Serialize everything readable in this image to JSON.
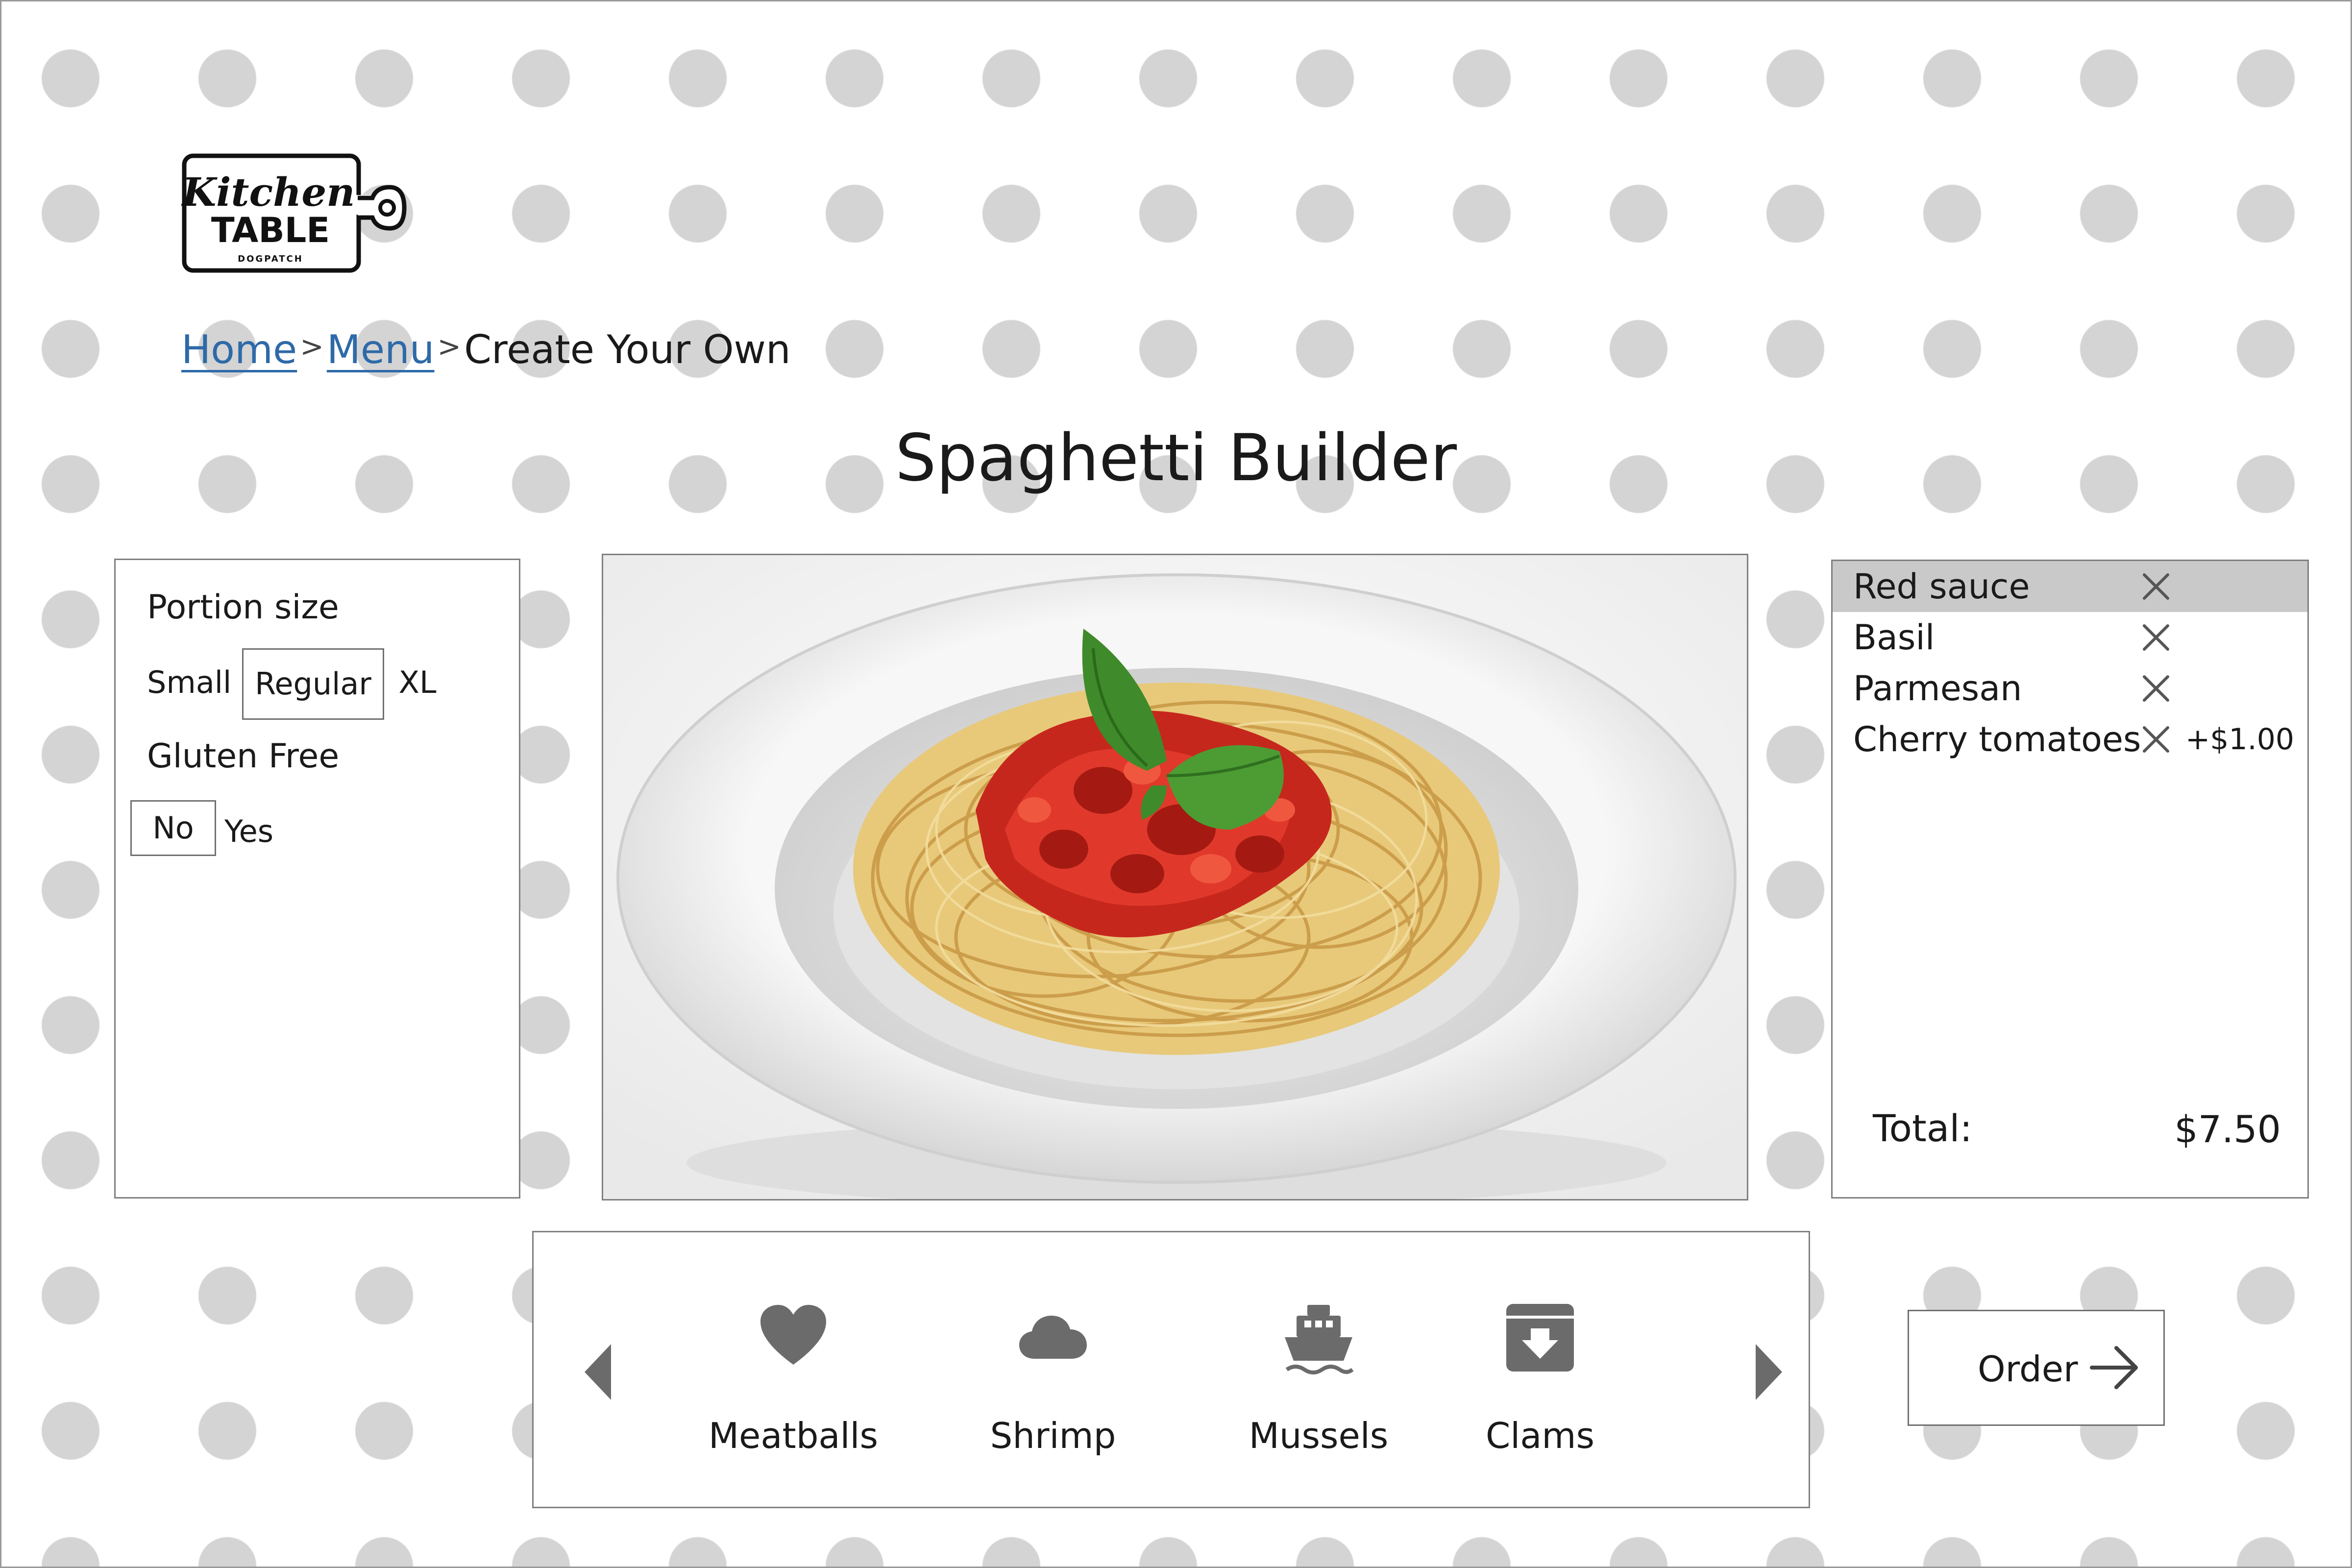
{
  "brand": {
    "logo_text_line1": "Kitchen",
    "logo_text_line2": "TABLE",
    "logo_text_line3": "DOGPATCH"
  },
  "breadcrumb": {
    "items": [
      "Home",
      "Menu"
    ],
    "current": "Create Your Own",
    "separator": ">"
  },
  "page": {
    "title": "Spaghetti Builder"
  },
  "options": {
    "portion": {
      "label": "Portion size",
      "choices": [
        "Small",
        "Regular",
        "XL"
      ],
      "selected": "Regular"
    },
    "gluten": {
      "label": "Gluten Free",
      "choices": [
        "No",
        "Yes"
      ],
      "selected": "No"
    }
  },
  "summary": {
    "items": [
      {
        "name": "Red sauce",
        "extra": "",
        "highlighted": true
      },
      {
        "name": "Basil",
        "extra": ""
      },
      {
        "name": "Parmesan",
        "extra": ""
      },
      {
        "name": "Cherry tomatoes",
        "extra": "+$1.00"
      }
    ],
    "total_label": "Total:",
    "total_value": "$7.50"
  },
  "toppings": {
    "items": [
      {
        "name": "Meatballs",
        "icon": "heart-icon"
      },
      {
        "name": "Shrimp",
        "icon": "cloud-icon"
      },
      {
        "name": "Mussels",
        "icon": "ship-icon"
      },
      {
        "name": "Clams",
        "icon": "archive-icon"
      }
    ],
    "prev_icon": "caret-left-icon",
    "next_icon": "caret-right-icon"
  },
  "order": {
    "label": "Order",
    "icon": "arrow-right-icon"
  },
  "colors": {
    "link": "#2e6aa8",
    "dots": "#d4d4d4",
    "icon": "#6b6b6b",
    "highlight": "#c9c9c9"
  }
}
